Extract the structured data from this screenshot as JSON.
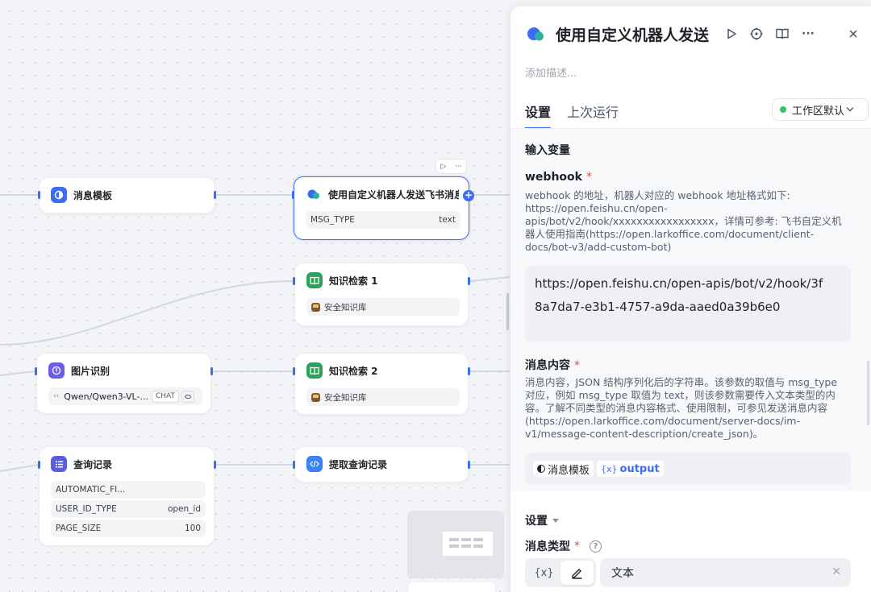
{
  "canvas": {
    "nodes": {
      "msg_template": {
        "title": "消息模板"
      },
      "feishu_send": {
        "title": "使用自定义机器人发送飞书消息",
        "row": {
          "key": "MSG_TYPE",
          "value": "text"
        }
      },
      "kb_search_1": {
        "title": "知识检索 1",
        "kb": "安全知识库"
      },
      "kb_search_2": {
        "title": "知识检索 2",
        "kb": "安全知识库"
      },
      "image_recog": {
        "title": "图片识别",
        "model": "Qwen/Qwen3-VL-...",
        "tag": "CHAT"
      },
      "query_log": {
        "title": "查询记录",
        "rows": [
          {
            "key": "AUTOMATIC_FI...",
            "value": ""
          },
          {
            "key": "USER_ID_TYPE",
            "value": "open_id"
          },
          {
            "key": "PAGE_SIZE",
            "value": "100"
          }
        ]
      },
      "extract_query": {
        "title": "提取查询记录"
      }
    }
  },
  "panel": {
    "title": "使用自定义机器人发送飞书消息",
    "description_placeholder": "添加描述...",
    "tabs": [
      {
        "label": "设置"
      },
      {
        "label": "上次运行"
      }
    ],
    "workspace": {
      "label": "工作区默认",
      "status_color": "#34c26b"
    },
    "input_section": "输入变量",
    "webhook": {
      "label": "webhook",
      "required": "*",
      "desc": "webhook 的地址，机器人对应的 webhook 地址格式如下: https://open.feishu.cn/open-apis/bot/v2/hook/xxxxxxxxxxxxxxxxx，详情可参考: 飞书自定义机器人使用指南(https://open.larkoffice.com/document/client-docs/bot-v3/add-custom-bot)",
      "value": "https://open.feishu.cn/open-apis/bot/v2/hook/3f8a7da7-e3b1-4757-a9da-aaed0a39b6e0"
    },
    "content": {
      "label": "消息内容",
      "required": "*",
      "desc": "消息内容，JSON 结构序列化后的字符串。该参数的取值与 msg_type 对应，例如 msg_type 取值为 text，则该参数需要传入文本类型的内容。了解不同类型的消息内容格式、使用限制，可参见发送消息内容(https://open.larkoffice.com/document/server-docs/im-v1/message-content-description/create_json)。",
      "chip_node": "消息模板",
      "chip_var_prefix": "{x}",
      "chip_var": "output"
    },
    "settings": {
      "title": "设置",
      "msg_type_label": "消息类型",
      "required": "*",
      "help": "?",
      "mode_var": "{x}",
      "value": "文本"
    }
  },
  "colors": {
    "accent": "#3b6cf6",
    "required": "#f04438"
  }
}
